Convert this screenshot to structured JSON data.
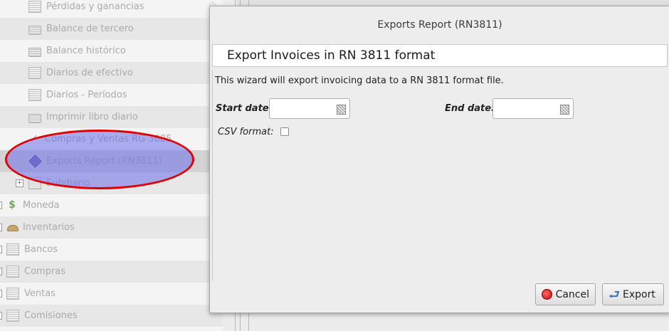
{
  "tree": {
    "items": [
      {
        "label": "Pérdidas y ganancias",
        "icon": "sheet-icon"
      },
      {
        "label": "Balance de tercero",
        "icon": "printer-icon"
      },
      {
        "label": "Balance histórico",
        "icon": "printer-icon"
      },
      {
        "label": "Diarios de efectivo",
        "icon": "sheet-icon"
      },
      {
        "label": "Diarios - Períodos",
        "icon": "sheet-icon"
      },
      {
        "label": "Imprimir libro diario",
        "icon": "printer-icon"
      },
      {
        "label": "Compras y Ventas RG 3685",
        "icon": "check-icon"
      },
      {
        "label": "Exports Report (RN3811)",
        "icon": "diamond-icon"
      },
      {
        "label": "Subdiario",
        "icon": "sheet-icon",
        "expander": "+"
      },
      {
        "label": "Moneda",
        "icon": "money-icon"
      },
      {
        "label": "Inventarios",
        "icon": "hat-icon"
      },
      {
        "label": "Bancos",
        "icon": "sheet-icon"
      },
      {
        "label": "Compras",
        "icon": "sheet-icon"
      },
      {
        "label": "Ventas",
        "icon": "sheet-icon"
      },
      {
        "label": "Comisiones",
        "icon": "sheet-icon"
      }
    ],
    "star_icon": "☆"
  },
  "dialog": {
    "title": "Exports Report (RN3811)",
    "header": "Export Invoices in RN 3811 format",
    "description": "This wizard will export invoicing data to a RN 3811 format file.",
    "start_date_label": "Start date:",
    "start_date_value": "",
    "end_date_label": "End date:",
    "end_date_value": "",
    "csv_label": "CSV format:",
    "csv_checked": false,
    "cancel_label": "Cancel",
    "export_label": "Export"
  },
  "colors": {
    "highlight_border": "#e00000",
    "highlight_fill": "#6e6eeb"
  }
}
